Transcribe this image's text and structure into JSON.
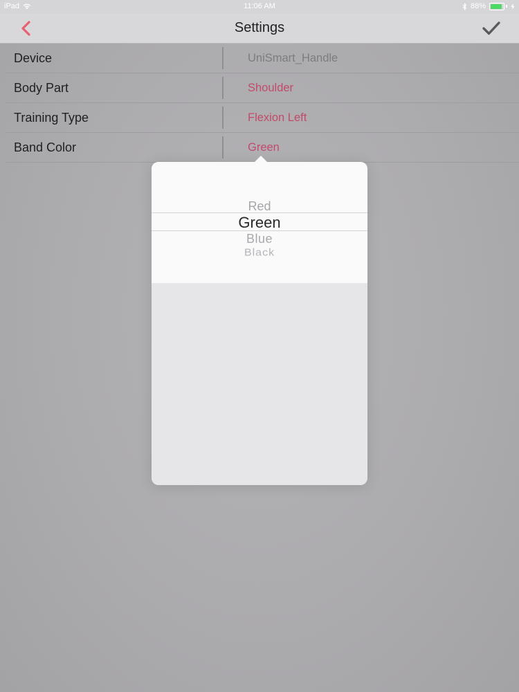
{
  "status_bar": {
    "carrier": "iPad",
    "time": "11:06 AM",
    "battery": "88%",
    "battery_level": 0.88,
    "icons": [
      "wifi-icon",
      "bluetooth-icon",
      "battery-icon"
    ]
  },
  "nav": {
    "title": "Settings",
    "back_icon": "chevron-left-icon",
    "done_icon": "checkmark-icon",
    "accent_color": "#e8606f"
  },
  "settings": {
    "rows": [
      {
        "label": "Device",
        "value": "UniSmart_Handle"
      },
      {
        "label": "Body Part",
        "value": "Shoulder"
      },
      {
        "label": "Training Type",
        "value": "Flexion Left"
      },
      {
        "label": "Band Color",
        "value": "Green"
      }
    ]
  },
  "picker": {
    "options": [
      "Red",
      "Green",
      "Blue",
      "Black"
    ],
    "selected": "Green"
  },
  "colors": {
    "value_gray": "#7d7c80",
    "value_pink": "#c24a6a",
    "battery_green": "#4cd964"
  }
}
